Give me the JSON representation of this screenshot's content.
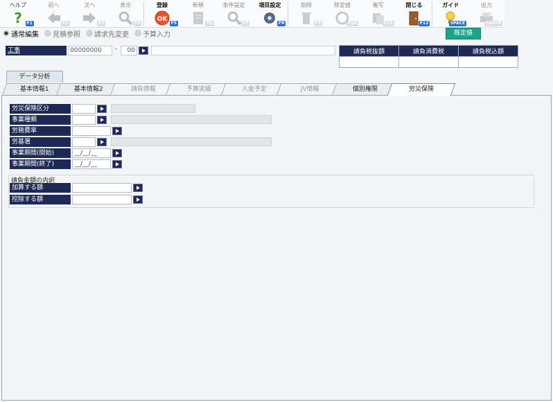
{
  "toolbar": {
    "buttons": [
      {
        "label": "ヘルプ",
        "fkey": "F1",
        "icon": "help-icon",
        "state": "active"
      },
      {
        "label": "前へ",
        "fkey": "F2",
        "icon": "prev-arrow-icon",
        "state": "disabled"
      },
      {
        "label": "次へ",
        "fkey": "F3",
        "icon": "next-arrow-icon",
        "state": "disabled"
      },
      {
        "label": "表示",
        "fkey": "F4",
        "icon": "magnifier-icon",
        "state": "disabled"
      },
      {
        "label": "登録",
        "fkey": "F5",
        "icon": "ok-icon",
        "state": "bold"
      },
      {
        "label": "新規",
        "fkey": "F6",
        "icon": "new-doc-icon",
        "state": "disabled"
      },
      {
        "label": "条件設定",
        "fkey": "F7",
        "icon": "condition-icon",
        "state": "disabled"
      },
      {
        "label": "項目設定",
        "fkey": "F8",
        "icon": "item-setting-icon",
        "state": "bold"
      },
      {
        "label": "削除",
        "fkey": "F9",
        "icon": "trash-icon",
        "state": "disabled"
      },
      {
        "label": "既定値",
        "fkey": "F10",
        "icon": "default-value-icon",
        "state": "disabled"
      },
      {
        "label": "複写",
        "fkey": "F11",
        "icon": "copy-icon",
        "state": "disabled"
      },
      {
        "label": "閉じる",
        "fkey": "F12",
        "icon": "door-icon",
        "state": "bold"
      },
      {
        "label": "ガイド",
        "fkey": "SPACE",
        "icon": "lightbulb-icon",
        "state": "bold"
      },
      {
        "label": "出力",
        "fkey": "Ctrl+P",
        "icon": "print-icon",
        "state": "disabled"
      }
    ]
  },
  "modes": [
    {
      "label": "通常編集",
      "active": true
    },
    {
      "label": "見積参照",
      "active": false
    },
    {
      "label": "請求先変更",
      "active": false
    },
    {
      "label": "予算入力",
      "active": false
    }
  ],
  "default_button": "既定値",
  "kouji": {
    "label": "工事",
    "code": "00000000",
    "dash": "-",
    "sub": "00"
  },
  "tax": {
    "headers": [
      "請負税抜額",
      "請負消費税",
      "請負税込額"
    ]
  },
  "data_tab": "データ分析",
  "tabs": [
    {
      "label": "基本情報1",
      "state": "enabled",
      "w": 88
    },
    {
      "label": "基本情報2",
      "state": "enabled",
      "w": 88
    },
    {
      "label": "請負情報",
      "state": "disabled",
      "w": 90
    },
    {
      "label": "予算実績",
      "state": "disabled",
      "w": 90
    },
    {
      "label": "入金予定",
      "state": "disabled",
      "w": 90
    },
    {
      "label": "JV情報",
      "state": "disabled",
      "w": 90
    },
    {
      "label": "個別権限",
      "state": "enabled",
      "w": 90
    },
    {
      "label": "労災保険",
      "state": "current",
      "w": 92
    }
  ],
  "fields": {
    "rousai_kubun": "労災保険区分",
    "jigyo_shurui": "事業種類",
    "romuhi_ritsu": "労務費率",
    "rokisho": "労基署",
    "kikan_start": "事業期間(開始)",
    "kikan_start_value": "__/__/__",
    "kikan_end": "事業期間(終了)",
    "kikan_end_value": "__/__/__"
  },
  "group": {
    "title": "請負金額の内訳",
    "add_label": "加算する額",
    "sub_label": "控除する額"
  }
}
